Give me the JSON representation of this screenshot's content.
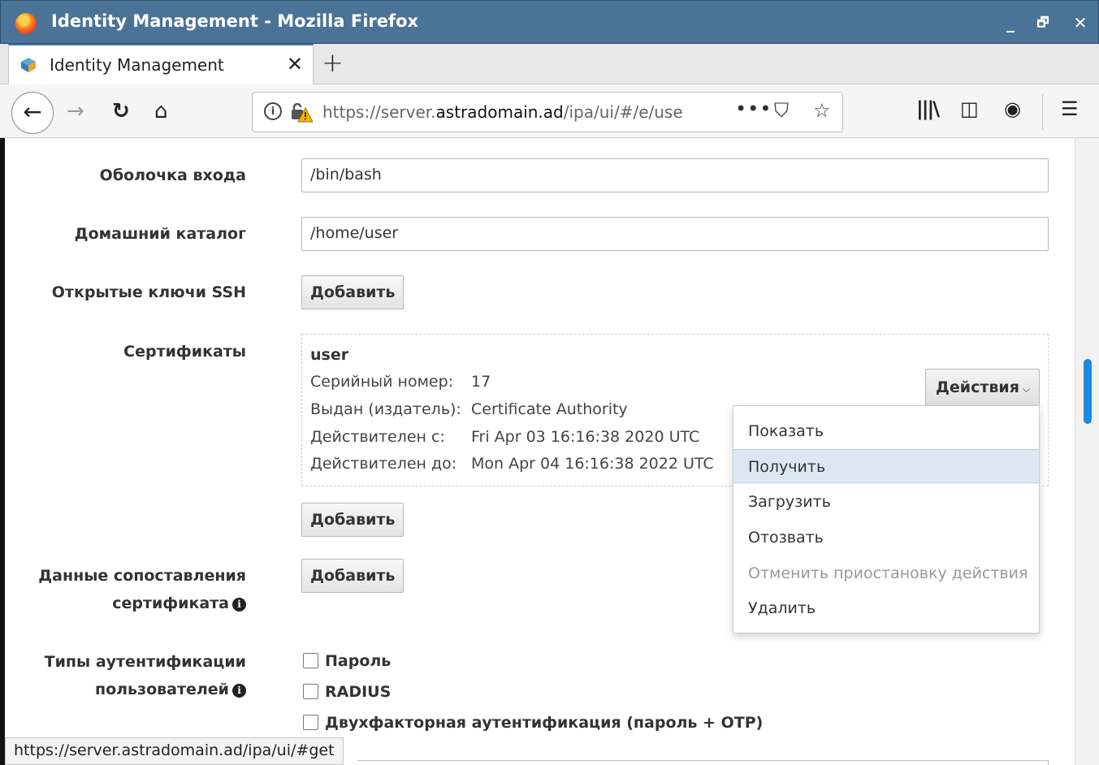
{
  "window": {
    "title": "Identity Management - Mozilla Firefox",
    "minimize": "_",
    "maximize": "🗗",
    "close": "✕"
  },
  "tab": {
    "title": "Identity Management",
    "close": "✕",
    "new_tab": "+"
  },
  "navbar": {
    "url_scheme_host_prefix": "https://server.",
    "url_domain": "astradomain.ad",
    "url_path": "/ipa/ui/#/e/use",
    "icons": [
      "back-icon",
      "forward-icon",
      "reload-icon",
      "home-icon",
      "info-icon",
      "insecure-lock-icon",
      "page-actions-icon",
      "pocket-icon",
      "bookmark-star-icon",
      "library-icon",
      "sidebar-icon",
      "account-icon",
      "menu-icon"
    ]
  },
  "form": {
    "login_shell_label": "Оболочка входа",
    "login_shell_value": "/bin/bash",
    "home_dir_label": "Домашний каталог",
    "home_dir_value": "/home/user",
    "ssh_keys_label": "Открытые ключи SSH",
    "add_label": "Добавить",
    "certificates_label": "Сертификаты",
    "cert_mapping_label_1": "Данные сопоставления",
    "cert_mapping_label_2": "сертификата",
    "auth_types_label_1": "Типы аутентификации",
    "auth_types_label_2": "пользователей",
    "auth_options": [
      "Пароль",
      "RADIUS",
      "Двухфакторная аутентификация (пароль + OTP)"
    ]
  },
  "certificate": {
    "name": "user",
    "serial_label": "Серийный номер:",
    "serial_value": "17",
    "issuer_label": "Выдан (издатель):",
    "issuer_value": "Certificate Authority",
    "valid_from_label": "Действителен с:",
    "valid_from_value": "Fri Apr 03 16:16:38 2020 UTC",
    "valid_to_label": "Действителен до:",
    "valid_to_value": "Mon Apr 04 16:16:38 2022 UTC"
  },
  "actions": {
    "button_label": "Действия",
    "menu": [
      {
        "label": "Показать",
        "state": "normal"
      },
      {
        "label": "Получить",
        "state": "hover"
      },
      {
        "label": "Загрузить",
        "state": "normal"
      },
      {
        "label": "Отозвать",
        "state": "normal"
      },
      {
        "label": "Отменить приостановку действия",
        "state": "disabled"
      },
      {
        "label": "Удалить",
        "state": "normal"
      }
    ]
  },
  "status_url": "https://server.astradomain.ad/ipa/ui/#get",
  "colors": {
    "titlebar": "#4b7397",
    "menu_hover": "#dbe8f4",
    "scroll_thumb": "#1e88e5"
  }
}
